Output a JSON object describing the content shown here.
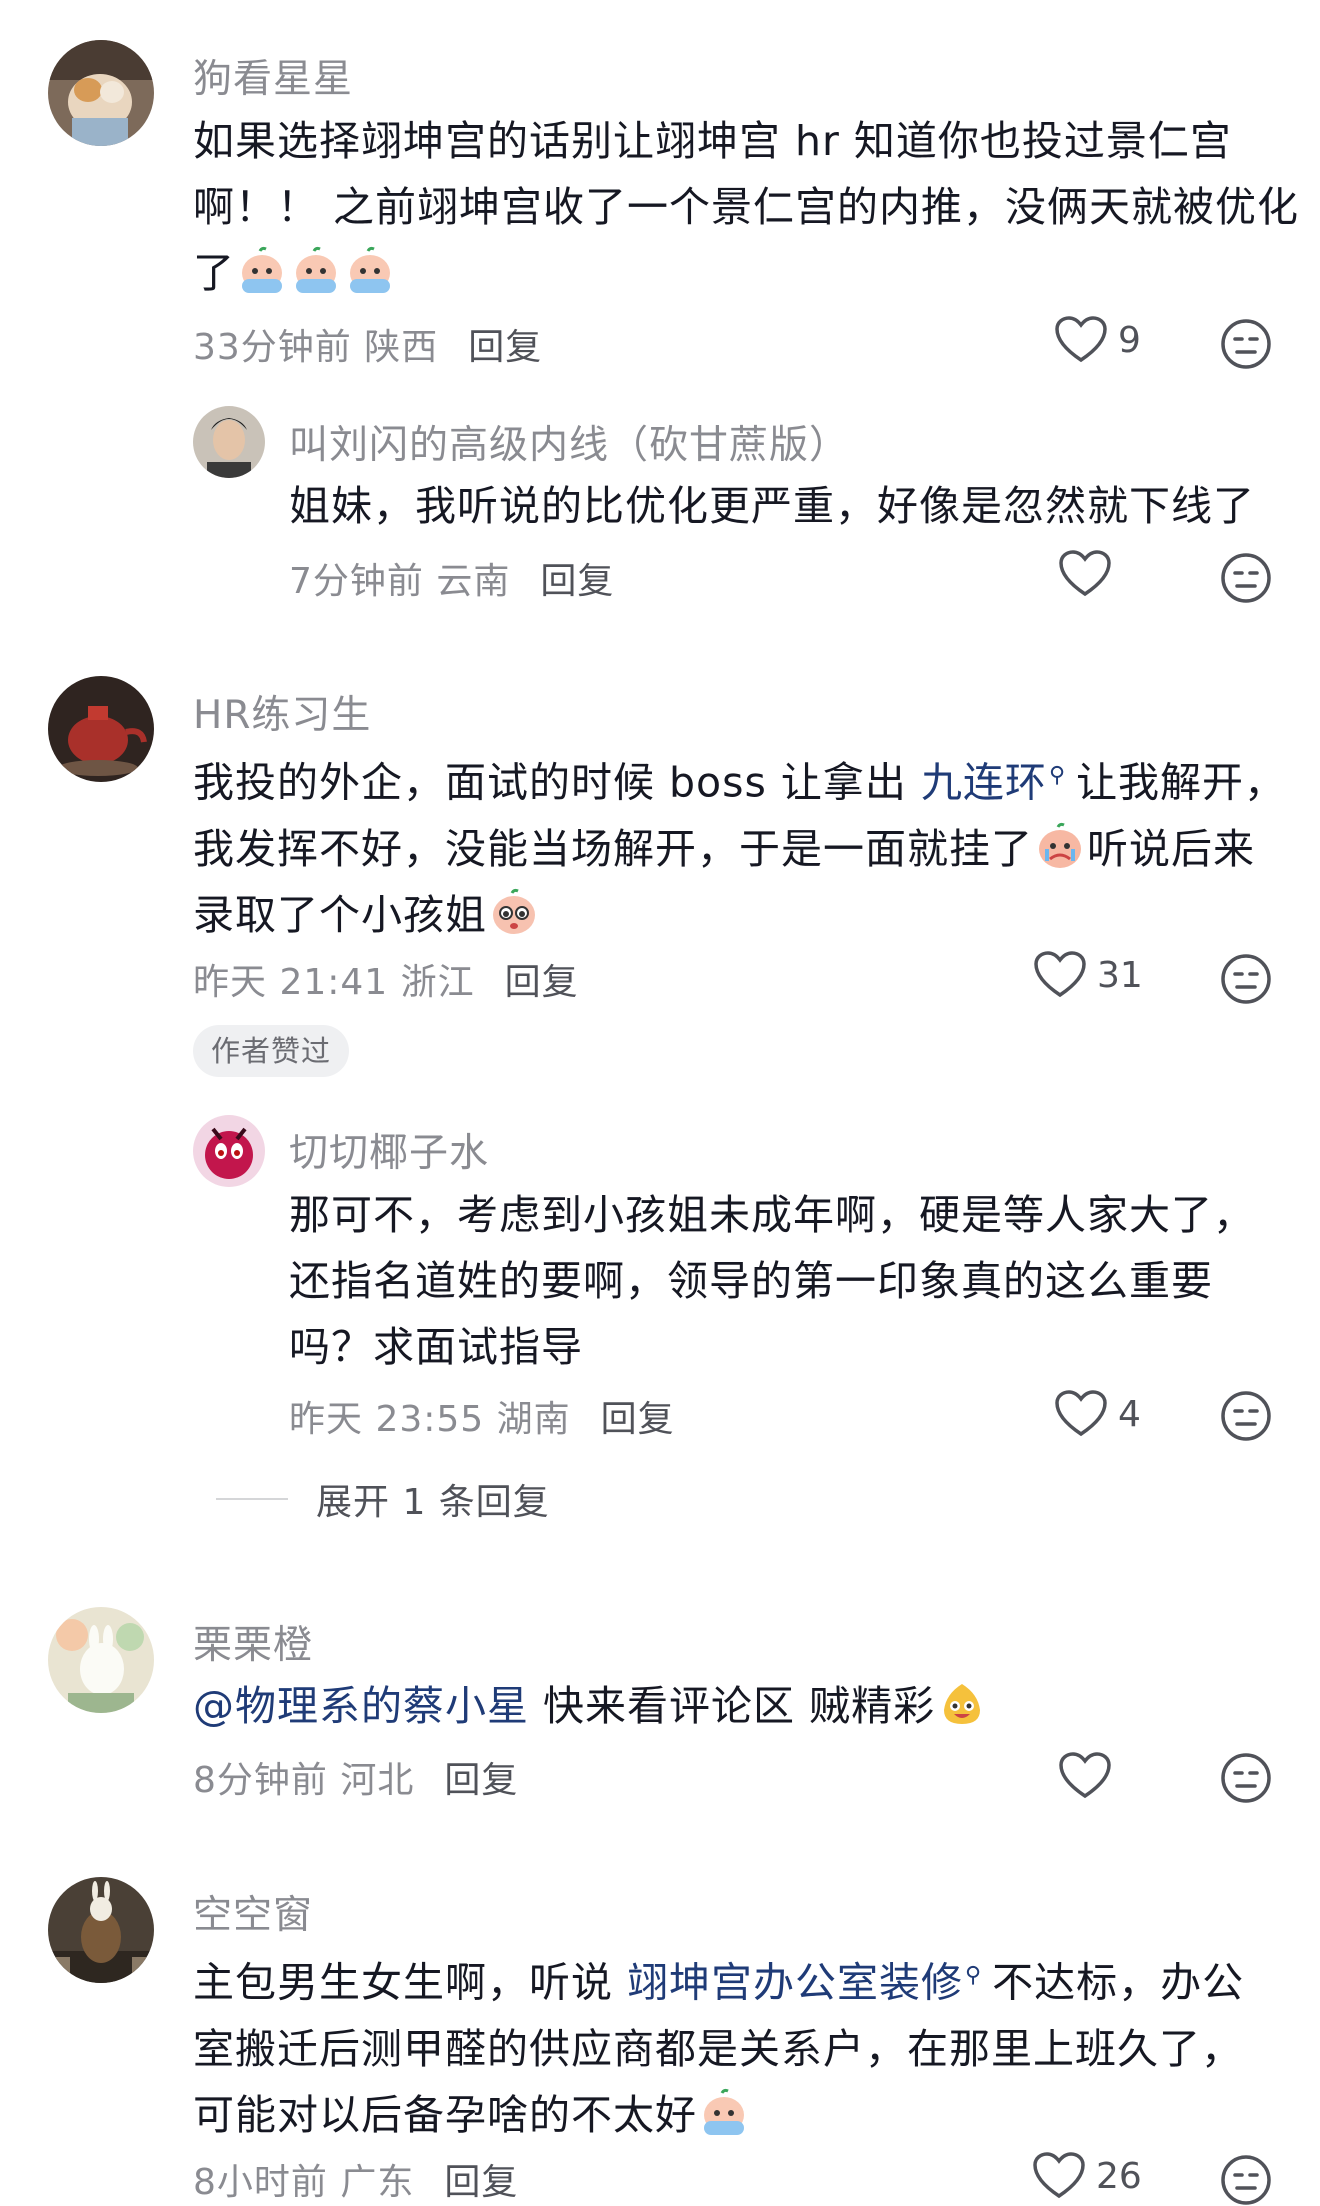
{
  "comments": [
    {
      "username": "狗看星星",
      "lines": [
        "如果选择翊坤宫的话别让翊坤宫 hr 知道你也投过景仁宫",
        "啊！！ 之前翊坤宫收了一个景仁宫的内推，没俩天就被优化",
        "了"
      ],
      "emojis": [
        "cry-emoji",
        "cry-emoji",
        "cry-emoji"
      ],
      "time": "33分钟前 陕西",
      "reply": "回复",
      "likes": "9"
    },
    {
      "username": "叫刘闪的高级内线（砍甘蔗版）",
      "lines": [
        "姐妹，我听说的比优化更严重，好像是忽然就下线了"
      ],
      "time": "7分钟前 云南",
      "reply": "回复",
      "likes": ""
    },
    {
      "username": "HR练习生",
      "line1_a": "我投的外企，面试的时候 boss 让拿出 ",
      "line1_link": "九连环",
      "line1_b": "让我解开，",
      "line2_a": "我发挥不好，没能当场解开，于是一面就挂了",
      "line2_b": "听说后来",
      "line3": "录取了个小孩姐",
      "time": "昨天 21:41 浙江",
      "reply": "回复",
      "likes": "31",
      "badge": "作者赞过"
    },
    {
      "username": "切切椰子水",
      "lines": [
        "那可不，考虑到小孩姐未成年啊，硬是等人家大了，",
        "还指名道姓的要啊，领导的第一印象真的这么重要",
        "吗？求面试指导"
      ],
      "time": "昨天 23:55 湖南",
      "reply": "回复",
      "likes": "4"
    },
    {
      "username": "栗栗橙",
      "mention": "@物理系的蔡小星",
      "rest": " 快来看评论区 贼精彩",
      "time": "8分钟前 河北",
      "reply": "回复",
      "likes": ""
    },
    {
      "username": "空空窗",
      "line1_a": "主包男生女生啊，听说 ",
      "line1_link": "翊坤宫办公室装修",
      "line1_b": "不达标，办公",
      "line2": "室搬迁后测甲醛的供应商都是关系户，在那里上班久了，",
      "line3": "可能对以后备孕啥的不太好",
      "time": "8小时前 广东",
      "reply": "回复",
      "likes": "26"
    }
  ],
  "expand_replies": "展开 1 条回复"
}
